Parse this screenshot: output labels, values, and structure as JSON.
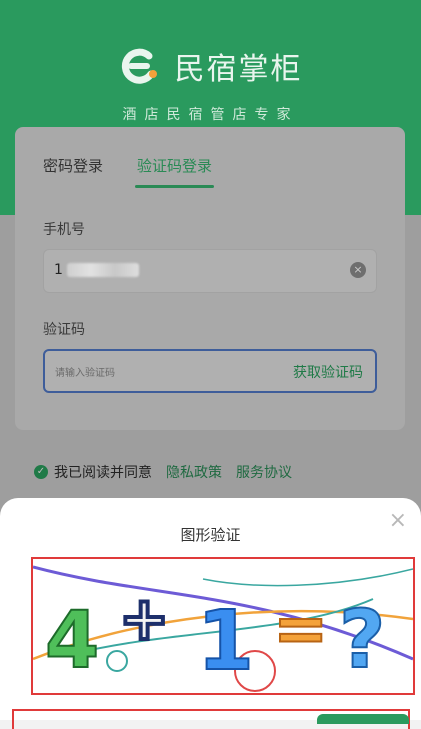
{
  "brand": {
    "name": "民宿掌柜",
    "slogan": "酒店民宿管店专家"
  },
  "login": {
    "tabs": [
      {
        "label": "密码登录",
        "active": false
      },
      {
        "label": "验证码登录",
        "active": true
      }
    ],
    "phone_label": "手机号",
    "phone_value_visible": "1",
    "code_label": "验证码",
    "code_placeholder": "请输入验证码",
    "get_code_label": "获取验证码"
  },
  "agreement": {
    "text": "我已阅读并同意",
    "privacy_link": "隐私政策",
    "service_link": "服务协议"
  },
  "captcha_sheet": {
    "title": "图形验证",
    "close": "×",
    "image_symbols": [
      "4",
      "+",
      "1",
      "=",
      "?"
    ]
  },
  "colors": {
    "accent_green": "#2a9a5e",
    "link_green": "#1f7a47",
    "highlight_red": "#e03a3a",
    "input_focus_blue": "#3e5d9a"
  }
}
